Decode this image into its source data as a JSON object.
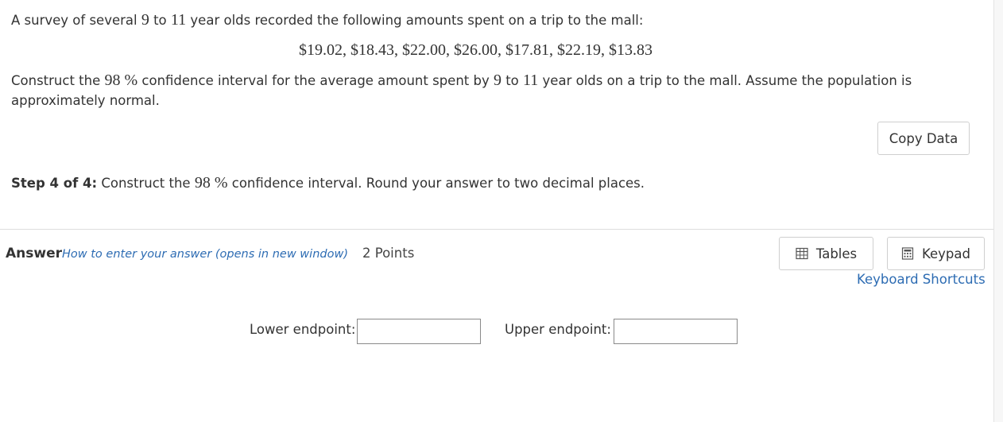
{
  "question": {
    "intro_before_a": "A survey of several ",
    "age_low": "9",
    "intro_to": " to ",
    "age_high": "11",
    "intro_after": " year olds recorded the following amounts spent on a trip to the mall:",
    "amounts": "$19.02, $18.43, $22.00, $26.00, $17.81, $22.19, $13.83",
    "construct_before": "Construct the ",
    "confidence_pct": "98 %",
    "construct_middle": " confidence interval for the average amount spent by ",
    "construct_age_low": "9",
    "construct_to": " to ",
    "construct_age_high": "11",
    "construct_after": " year olds on a trip to the mall. Assume the population is approximately normal."
  },
  "copy_data": {
    "label": "Copy Data"
  },
  "step": {
    "label": "Step 4 of 4:",
    "text_before": " Construct the ",
    "confidence_pct": "98 %",
    "text_after": " confidence interval. Round your answer to two decimal places."
  },
  "answer": {
    "label": "Answer",
    "howto_link": "How to enter your answer (opens in new window)",
    "points": "2 Points"
  },
  "toolbar": {
    "tables_label": "Tables",
    "keypad_label": "Keypad",
    "shortcuts_label": "Keyboard Shortcuts",
    "tables_icon": "table-grid-icon",
    "keypad_icon": "calculator-keypad-icon"
  },
  "fields": {
    "lower_label": "Lower endpoint:",
    "lower_value": "",
    "upper_label": "Upper endpoint:",
    "upper_value": ""
  },
  "colors": {
    "link": "#2d6cb3",
    "text": "#333333",
    "border": "#cfcfcf"
  }
}
